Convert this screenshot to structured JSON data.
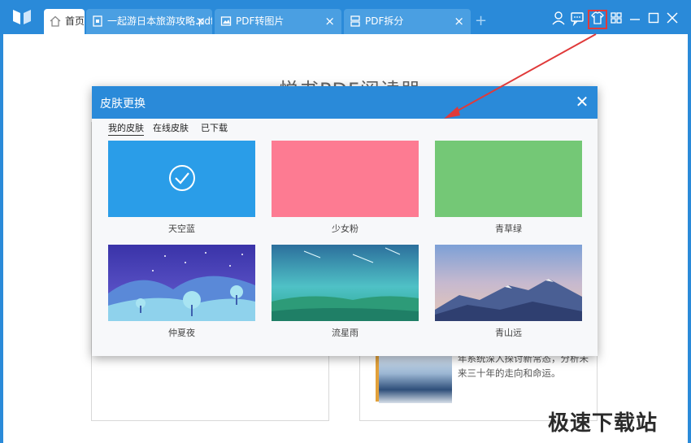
{
  "tabs": [
    {
      "label": "首页",
      "active": true
    },
    {
      "label": "一起游日本旅游攻略.pdf",
      "active": false
    },
    {
      "label": "PDF转图片",
      "active": false
    },
    {
      "label": "PDF拆分",
      "active": false
    }
  ],
  "window_controls": [
    "user-icon",
    "message-icon",
    "skin-icon",
    "grid-icon",
    "minimize-icon",
    "maximize-icon",
    "close-icon"
  ],
  "main": {
    "app_title": "悦书PDF阅读器",
    "book_text": [
      "年系统深入探讨新常态，分析未",
      "来三十年的走向和命运。"
    ]
  },
  "dialog": {
    "title": "皮肤更换",
    "tabs": [
      {
        "label": "我的皮肤",
        "active": true
      },
      {
        "label": "在线皮肤",
        "active": false
      },
      {
        "label": "已下载",
        "active": false
      }
    ],
    "skins": [
      {
        "name": "天空蓝",
        "color": "#2a9de8",
        "selected": true
      },
      {
        "name": "少女粉",
        "color": "#fd7b92",
        "selected": false
      },
      {
        "name": "青草绿",
        "color": "#74c876",
        "selected": false
      },
      {
        "name": "仲夏夜",
        "selected": false
      },
      {
        "name": "流星雨",
        "selected": false
      },
      {
        "name": "青山远",
        "selected": false
      }
    ]
  },
  "watermark": "极速下载站",
  "colors": {
    "accent": "#2a8ad9",
    "highlight": "#e03a3a"
  }
}
